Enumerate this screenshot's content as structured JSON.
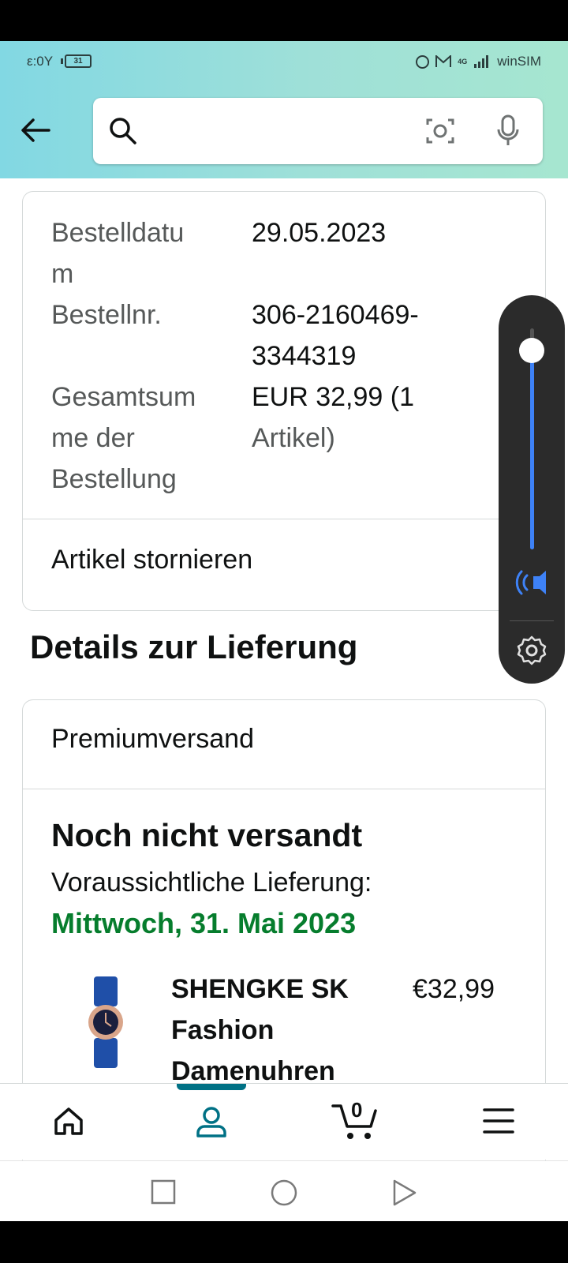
{
  "status_bar": {
    "time": "ε:0Y",
    "battery": "31",
    "carrier": "winSIM",
    "network": "4G"
  },
  "search": {
    "placeholder": ""
  },
  "order": {
    "date_label_1": "Bestelldatu",
    "date_label_2": "m",
    "date_value": "29.05.2023",
    "number_label": "Bestellnr.",
    "number_value_1": "306-2160469-",
    "number_value_2": "3344319",
    "total_label_1": "Gesamtsum",
    "total_label_2": "me der",
    "total_label_3": "Bestellung",
    "total_value_1": "EUR 32,99 (1",
    "total_value_2": "Artikel)",
    "cancel_label": "Artikel stornieren"
  },
  "delivery": {
    "section_title": "Details zur Lieferung",
    "shipping_method": "Premiumversand",
    "status": "Noch nicht versandt",
    "expected_label": "Voraussichtliche Lieferung:",
    "expected_date": "Mittwoch, 31. Mai 2023",
    "product_line_1": "SHENGKE SK",
    "product_line_2": "Fashion",
    "product_line_3": "Damenuhren",
    "price": "€32,99"
  },
  "volume": {
    "level": 0.9,
    "accent": "#3e82f7"
  },
  "bottom_nav": {
    "cart_count": "0",
    "active": "account"
  },
  "colors": {
    "accent_teal": "#007185",
    "delivery_green": "#067d2d"
  }
}
